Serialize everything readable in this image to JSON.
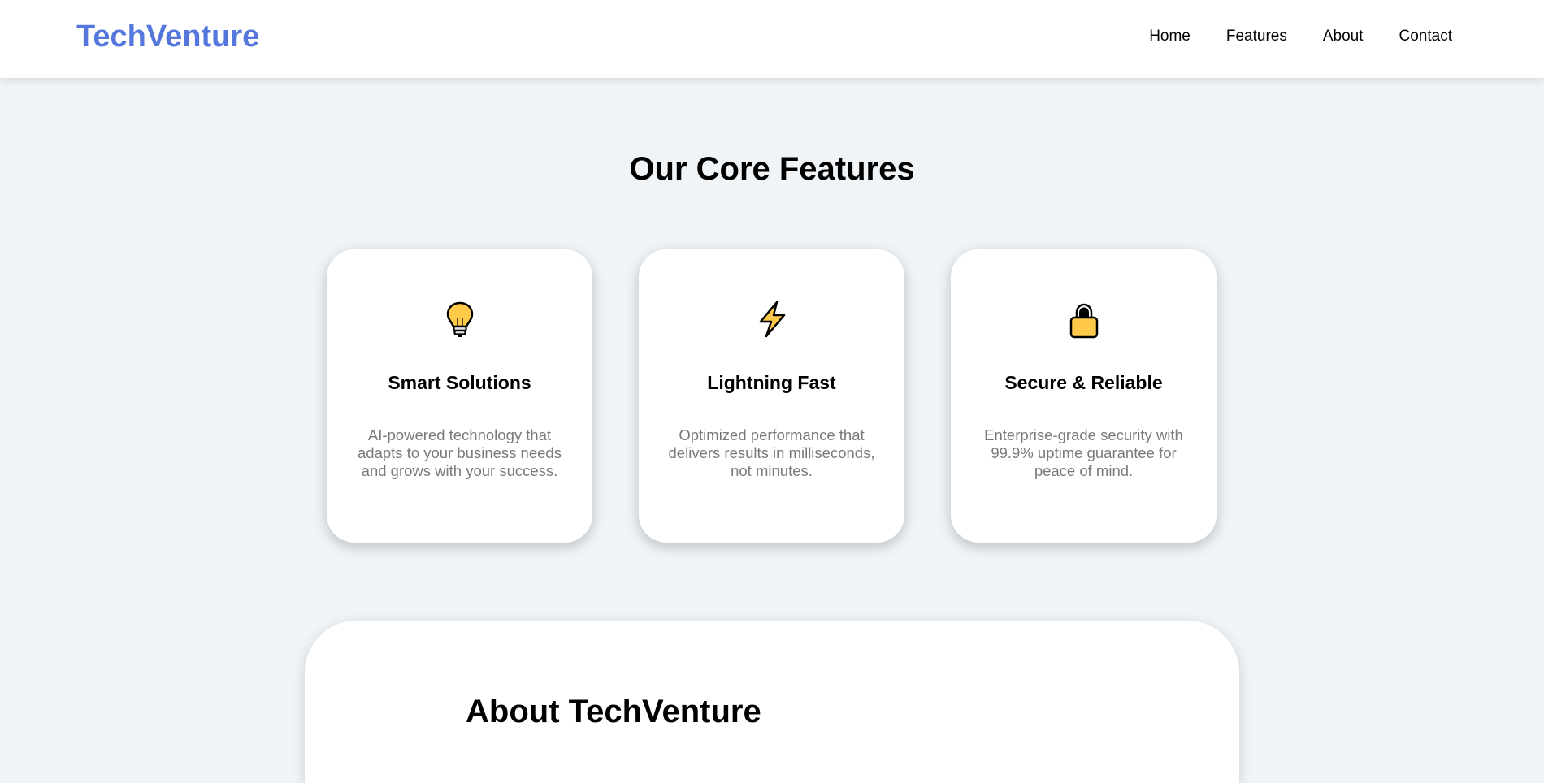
{
  "header": {
    "logo": "TechVenture",
    "nav": [
      "Home",
      "Features",
      "About",
      "Contact"
    ]
  },
  "features": {
    "title": "Our Core Features",
    "cards": [
      {
        "icon": "lightbulb-icon",
        "title": "Smart Solutions",
        "description": "AI-powered technology that adapts to your business needs and grows with your success."
      },
      {
        "icon": "lightning-icon",
        "title": "Lightning Fast",
        "description": "Optimized performance that delivers results in milliseconds, not minutes."
      },
      {
        "icon": "lock-icon",
        "title": "Secure & Reliable",
        "description": "Enterprise-grade security with 99.9% uptime guarantee for peace of mind."
      }
    ]
  },
  "about": {
    "title": "About TechVenture"
  },
  "colors": {
    "brand": "#5577dd",
    "background": "#f0f4f7",
    "icon_fill": "#ffc94a",
    "description_text": "#7a7a7a"
  }
}
